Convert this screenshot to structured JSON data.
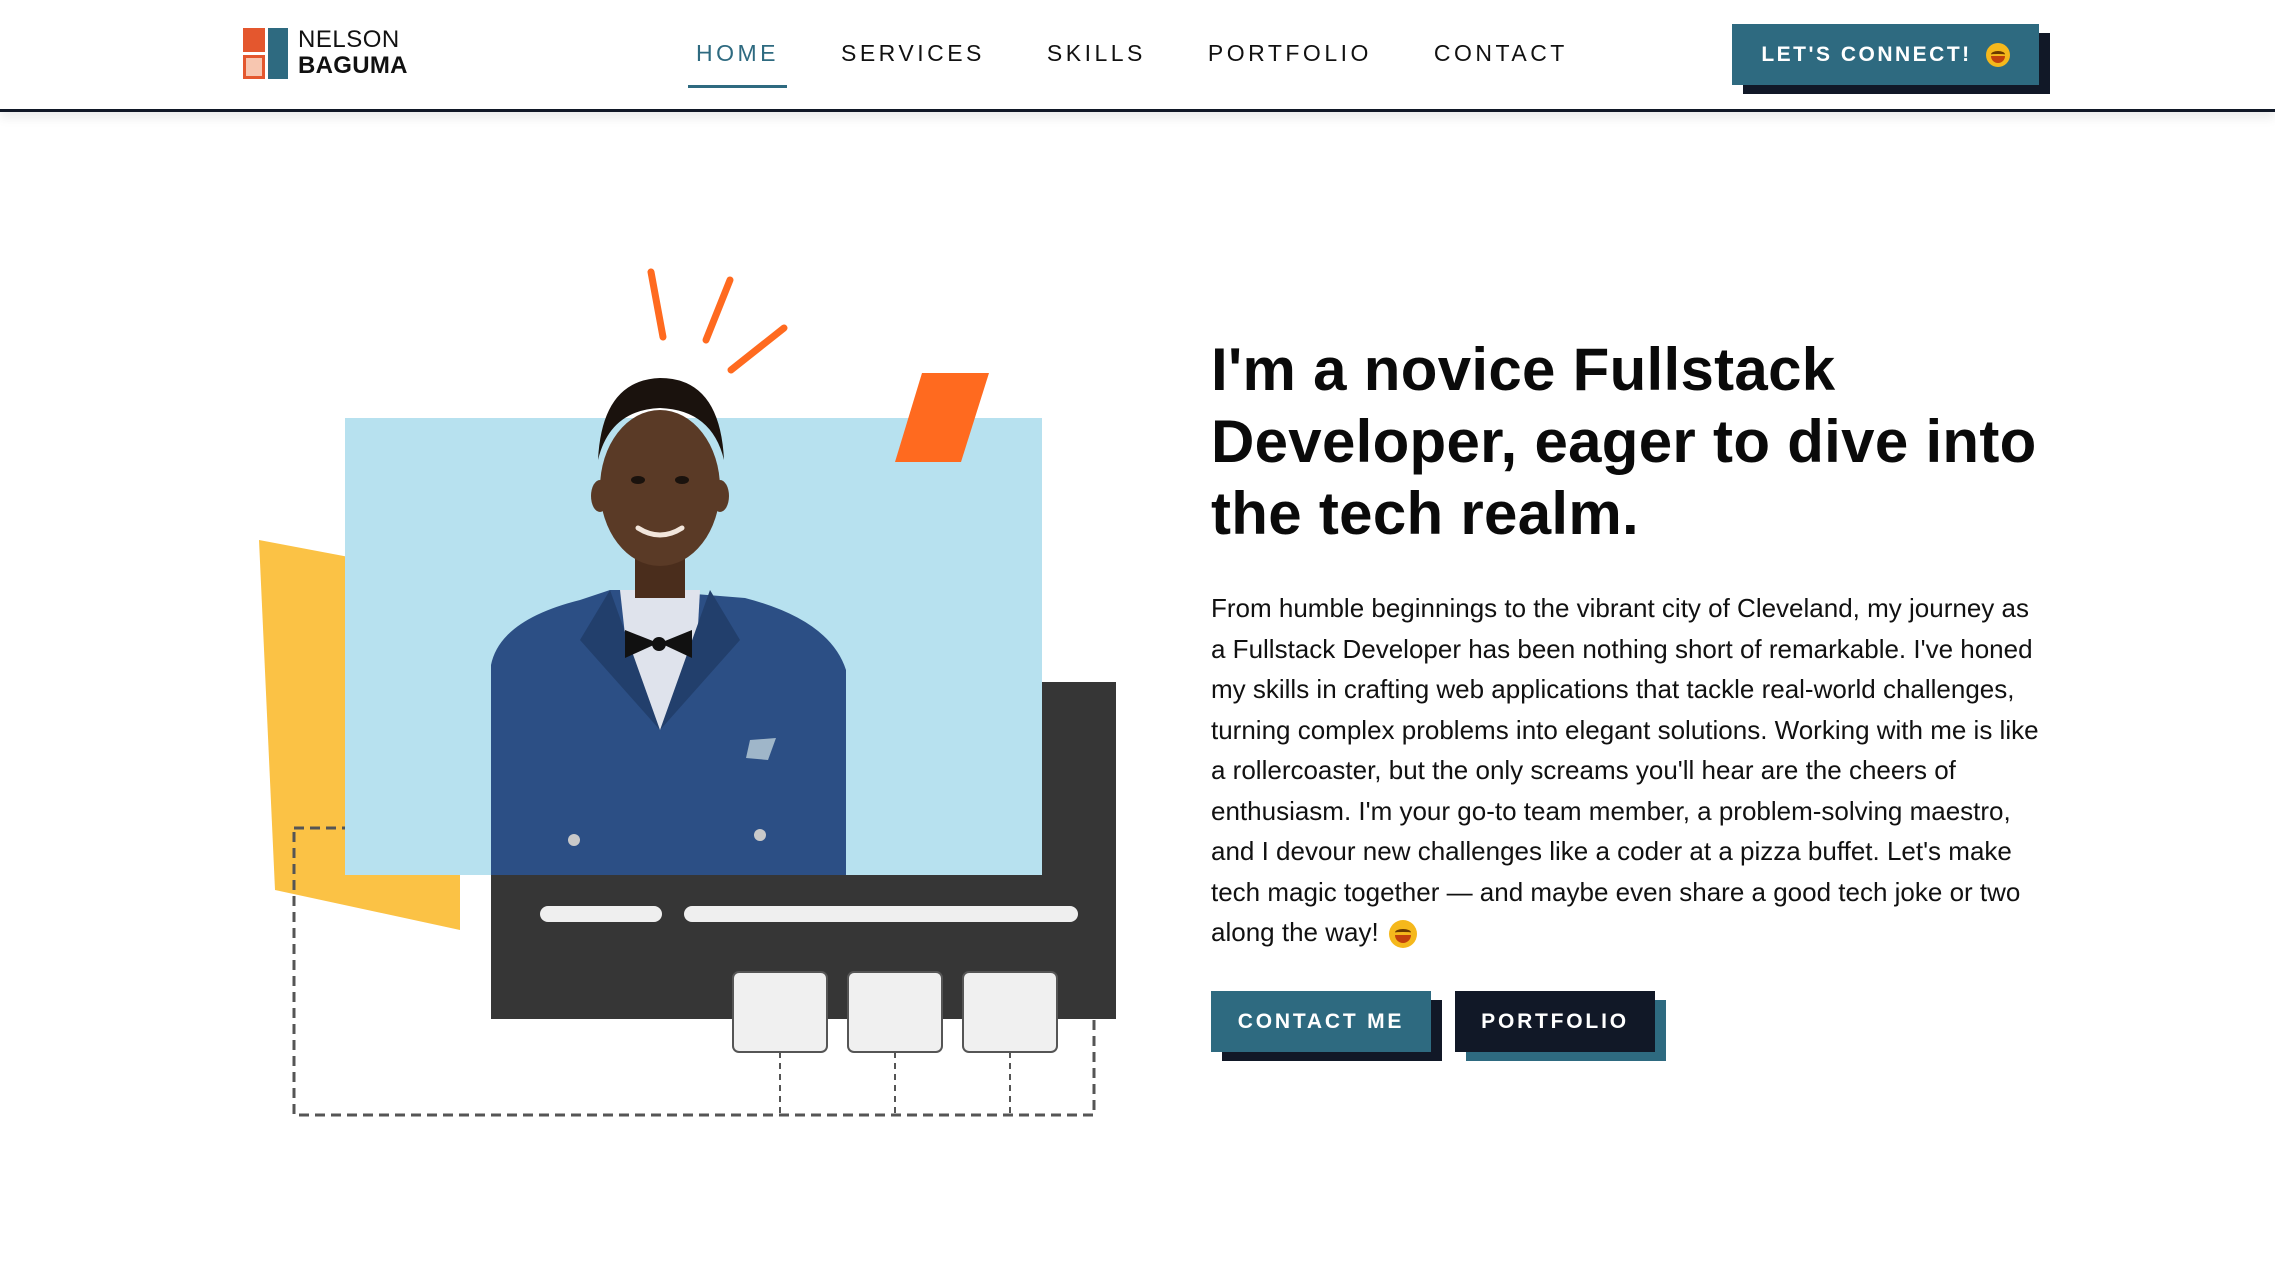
{
  "brand": {
    "line1": "NELSON",
    "line2": "BAGUMA",
    "colors": {
      "orange": "#e4572e",
      "teal": "#2e6a80",
      "navy": "#111827"
    }
  },
  "nav": {
    "items": [
      {
        "label": "HOME",
        "active": true
      },
      {
        "label": "SERVICES",
        "active": false
      },
      {
        "label": "SKILLS",
        "active": false
      },
      {
        "label": "PORTFOLIO",
        "active": false
      },
      {
        "label": "CONTACT",
        "active": false
      }
    ]
  },
  "header": {
    "cta_label": "LET'S CONNECT!",
    "cta_icon": "grinning-face-emoji"
  },
  "hero": {
    "headline": "I'm a novice Fullstack Developer, eager to dive into the tech realm.",
    "bio": "From humble beginnings to the vibrant city of Cleveland, my journey as a Fullstack Developer has been nothing short of remarkable. I've honed my skills in crafting web applications that tackle real-world challenges, turning complex problems into elegant solutions. Working with me is like a rollercoaster, but the only screams you'll hear are the cheers of enthusiasm. I'm your go-to team member, a problem-solving maestro, and I devour new challenges like a coder at a pizza buffet. Let's make tech magic together — and maybe even share a good tech joke or two along the way!",
    "bio_icon": "grinning-face-emoji",
    "contact_button": "CONTACT ME",
    "portfolio_button": "PORTFOLIO"
  },
  "illustration": {
    "colors": {
      "sky": "#b7e1ef",
      "yellow": "#fbc245",
      "dark": "#363636",
      "accent": "#ff6a1f"
    }
  }
}
